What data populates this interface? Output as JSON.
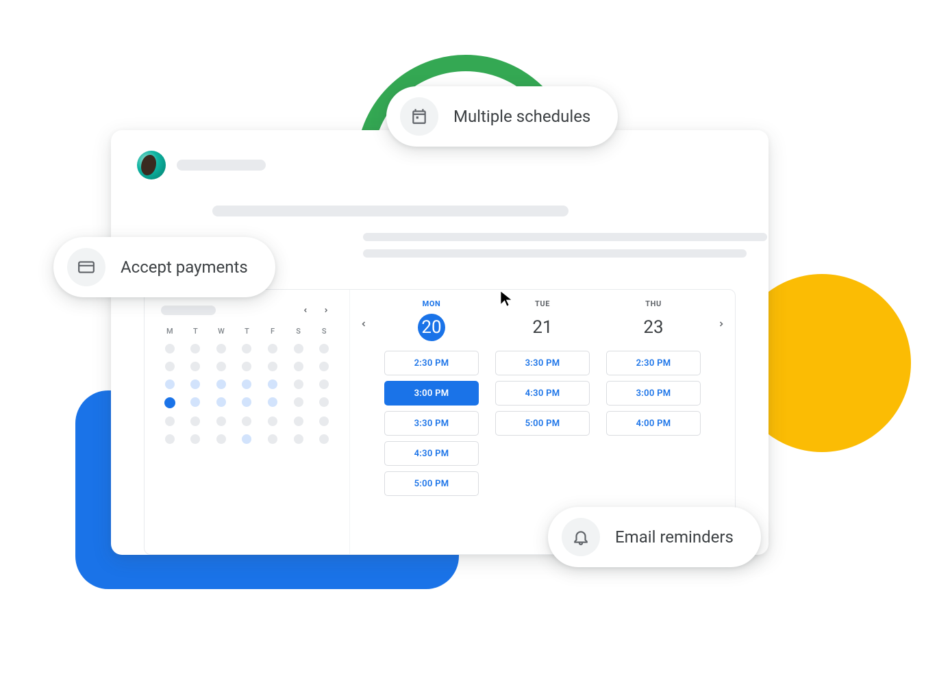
{
  "pills": {
    "schedules": "Multiple schedules",
    "payments": "Accept payments",
    "reminders": "Email reminders"
  },
  "mini_cal": {
    "dow": [
      "M",
      "T",
      "W",
      "T",
      "F",
      "S",
      "S"
    ],
    "weeks": [
      [
        "g",
        "g",
        "g",
        "g",
        "g",
        "g",
        "g"
      ],
      [
        "g",
        "g",
        "g",
        "g",
        "g",
        "g",
        "g"
      ],
      [
        "a",
        "a",
        "a",
        "a",
        "a",
        "g",
        "g"
      ],
      [
        "t",
        "a",
        "a",
        "a",
        "a",
        "g",
        "g"
      ],
      [
        "g",
        "g",
        "g",
        "g",
        "g",
        "g",
        "g"
      ],
      [
        "g",
        "g",
        "g",
        "a",
        "g",
        "g",
        "g"
      ]
    ]
  },
  "day_headers": [
    {
      "dow": "MON",
      "num": "20",
      "active": true
    },
    {
      "dow": "TUE",
      "num": "21",
      "active": false
    },
    {
      "dow": "THU",
      "num": "23",
      "active": false
    }
  ],
  "slots": [
    [
      "2:30 PM",
      "3:00 PM",
      "3:30 PM",
      "4:30 PM",
      "5:00 PM"
    ],
    [
      "3:30 PM",
      "4:30 PM",
      "5:00 PM"
    ],
    [
      "2:30 PM",
      "3:00 PM",
      "4:00 PM"
    ]
  ],
  "selected_slot": {
    "col": 0,
    "row": 1
  }
}
